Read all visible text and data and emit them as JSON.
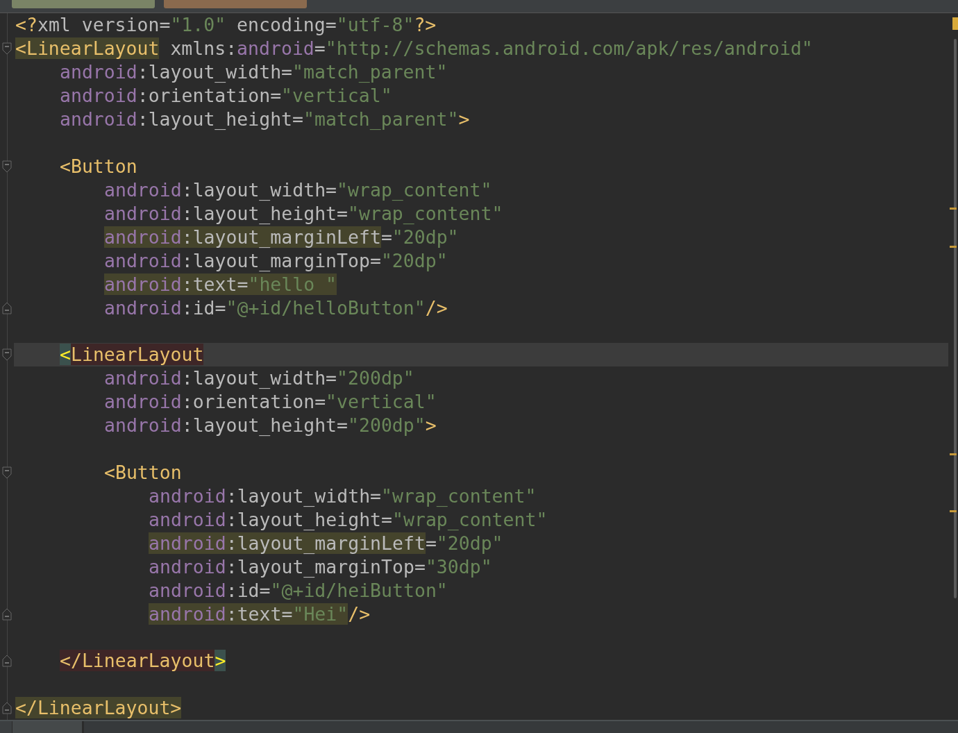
{
  "editor_tabs": [
    {
      "selected": false
    },
    {
      "selected": true
    }
  ],
  "lines": [
    {
      "current": false,
      "fold_start": false,
      "fold_end": false,
      "tokens": [
        {
          "kind": "bracket",
          "text": "<?",
          "warn": false,
          "match": false
        },
        {
          "kind": "attr",
          "text": "xml version=",
          "warn": false,
          "match": false
        },
        {
          "kind": "value",
          "text": "\"1.0\"",
          "warn": false,
          "match": false
        },
        {
          "kind": "attr",
          "text": " encoding=",
          "warn": false,
          "match": false
        },
        {
          "kind": "value",
          "text": "\"utf-8\"",
          "warn": false,
          "match": false
        },
        {
          "kind": "bracket",
          "text": "?>",
          "warn": false,
          "match": false
        }
      ]
    },
    {
      "current": false,
      "fold_start": true,
      "fold_end": false,
      "tokens": [
        {
          "kind": "tag",
          "text": "<LinearLayout",
          "warn": true,
          "match": false
        },
        {
          "kind": "attr",
          "text": " xmlns:",
          "warn": false,
          "match": false
        },
        {
          "kind": "ns",
          "text": "android",
          "warn": false,
          "match": false
        },
        {
          "kind": "attr",
          "text": "=",
          "warn": false,
          "match": false
        },
        {
          "kind": "value",
          "text": "\"http://schemas.android.com/apk/res/android\"",
          "warn": false,
          "match": false
        }
      ],
      "children": [
        {
          "current": false,
          "fold_start": false,
          "fold_end": false,
          "tokens": [
            {
              "kind": "ns",
              "text": "android",
              "warn": false,
              "match": false
            },
            {
              "kind": "attr",
              "text": ":layout_width=",
              "warn": false,
              "match": false
            },
            {
              "kind": "value",
              "text": "\"match_parent\"",
              "warn": false,
              "match": false
            }
          ]
        },
        {
          "current": false,
          "fold_start": false,
          "fold_end": false,
          "tokens": [
            {
              "kind": "ns",
              "text": "android",
              "warn": false,
              "match": false
            },
            {
              "kind": "attr",
              "text": ":orientation=",
              "warn": false,
              "match": false
            },
            {
              "kind": "value",
              "text": "\"vertical\"",
              "warn": false,
              "match": false
            }
          ]
        },
        {
          "current": false,
          "fold_start": false,
          "fold_end": false,
          "tokens": [
            {
              "kind": "ns",
              "text": "android",
              "warn": false,
              "match": false
            },
            {
              "kind": "attr",
              "text": ":layout_height=",
              "warn": false,
              "match": false
            },
            {
              "kind": "value",
              "text": "\"match_parent\"",
              "warn": false,
              "match": false
            },
            {
              "kind": "bracket",
              "text": ">",
              "warn": false,
              "match": false
            }
          ]
        },
        {
          "current": false,
          "fold_start": false,
          "fold_end": false
        },
        {
          "current": false,
          "fold_start": true,
          "fold_end": false,
          "tokens": [
            {
              "kind": "tag",
              "text": "<Button",
              "warn": false,
              "match": false
            }
          ],
          "children": [
            {
              "current": false,
              "fold_start": false,
              "fold_end": false,
              "tokens": [
                {
                  "kind": "ns",
                  "text": "android",
                  "warn": false,
                  "match": false
                },
                {
                  "kind": "attr",
                  "text": ":layout_width=",
                  "warn": false,
                  "match": false
                },
                {
                  "kind": "value",
                  "text": "\"wrap_content\"",
                  "warn": false,
                  "match": false
                }
              ]
            },
            {
              "current": false,
              "fold_start": false,
              "fold_end": false,
              "tokens": [
                {
                  "kind": "ns",
                  "text": "android",
                  "warn": false,
                  "match": false
                },
                {
                  "kind": "attr",
                  "text": ":layout_height=",
                  "warn": false,
                  "match": false
                },
                {
                  "kind": "value",
                  "text": "\"wrap_content\"",
                  "warn": false,
                  "match": false
                }
              ]
            },
            {
              "current": false,
              "fold_start": false,
              "fold_end": false,
              "tokens": [
                {
                  "kind": "ns",
                  "text": "android",
                  "warn": true,
                  "match": false
                },
                {
                  "kind": "attr",
                  "text": ":layout_marginLeft",
                  "warn": true,
                  "match": false
                },
                {
                  "kind": "attr",
                  "text": "=",
                  "warn": false,
                  "match": false
                },
                {
                  "kind": "value",
                  "text": "\"20dp\"",
                  "warn": false,
                  "match": false
                }
              ]
            },
            {
              "current": false,
              "fold_start": false,
              "fold_end": false,
              "tokens": [
                {
                  "kind": "ns",
                  "text": "android",
                  "warn": false,
                  "match": false
                },
                {
                  "kind": "attr",
                  "text": ":layout_marginTop=",
                  "warn": false,
                  "match": false
                },
                {
                  "kind": "value",
                  "text": "\"20dp\"",
                  "warn": false,
                  "match": false
                }
              ]
            },
            {
              "current": false,
              "fold_start": false,
              "fold_end": false,
              "tokens": [
                {
                  "kind": "ns",
                  "text": "android",
                  "warn": true,
                  "match": false
                },
                {
                  "kind": "attr",
                  "text": ":text=",
                  "warn": true,
                  "match": false
                },
                {
                  "kind": "value",
                  "text": "\"hello \"",
                  "warn": true,
                  "match": false
                }
              ]
            },
            {
              "current": false,
              "fold_start": false,
              "fold_end": true,
              "tokens": [
                {
                  "kind": "ns",
                  "text": "android",
                  "warn": false,
                  "match": false
                },
                {
                  "kind": "attr",
                  "text": ":id=",
                  "warn": false,
                  "match": false
                },
                {
                  "kind": "value",
                  "text": "\"@+id/helloButton\"",
                  "warn": false,
                  "match": false
                },
                {
                  "kind": "bracket",
                  "text": "/>",
                  "warn": false,
                  "match": false
                }
              ]
            }
          ]
        },
        {
          "current": false,
          "fold_start": false,
          "fold_end": false
        },
        {
          "current": true,
          "fold_start": true,
          "fold_end": false,
          "tokens": [
            {
              "kind": "bracket",
              "text": "<",
              "warn": false,
              "match": true
            },
            {
              "kind": "tag",
              "text": "LinearLayout",
              "warn": false,
              "match": true
            }
          ],
          "children": [
            {
              "current": false,
              "fold_start": false,
              "fold_end": false,
              "tokens": [
                {
                  "kind": "ns",
                  "text": "android",
                  "warn": false,
                  "match": false
                },
                {
                  "kind": "attr",
                  "text": ":layout_width=",
                  "warn": false,
                  "match": false
                },
                {
                  "kind": "value",
                  "text": "\"200dp\"",
                  "warn": false,
                  "match": false
                }
              ]
            },
            {
              "current": false,
              "fold_start": false,
              "fold_end": false,
              "tokens": [
                {
                  "kind": "ns",
                  "text": "android",
                  "warn": false,
                  "match": false
                },
                {
                  "kind": "attr",
                  "text": ":orientation=",
                  "warn": false,
                  "match": false
                },
                {
                  "kind": "value",
                  "text": "\"vertical\"",
                  "warn": false,
                  "match": false
                }
              ]
            },
            {
              "current": false,
              "fold_start": false,
              "fold_end": false,
              "tokens": [
                {
                  "kind": "ns",
                  "text": "android",
                  "warn": false,
                  "match": false
                },
                {
                  "kind": "attr",
                  "text": ":layout_height=",
                  "warn": false,
                  "match": false
                },
                {
                  "kind": "value",
                  "text": "\"200dp\"",
                  "warn": false,
                  "match": false
                },
                {
                  "kind": "bracket",
                  "text": ">",
                  "warn": false,
                  "match": false
                }
              ]
            },
            {
              "current": false,
              "fold_start": false,
              "fold_end": false
            },
            {
              "current": false,
              "fold_start": true,
              "fold_end": false,
              "tokens": [
                {
                  "kind": "tag",
                  "text": "<Button",
                  "warn": false,
                  "match": false
                }
              ],
              "children": [
                {
                  "current": false,
                  "fold_start": false,
                  "fold_end": false,
                  "tokens": [
                    {
                      "kind": "ns",
                      "text": "android",
                      "warn": false,
                      "match": false
                    },
                    {
                      "kind": "attr",
                      "text": ":layout_width=",
                      "warn": false,
                      "match": false
                    },
                    {
                      "kind": "value",
                      "text": "\"wrap_content\"",
                      "warn": false,
                      "match": false
                    }
                  ]
                },
                {
                  "current": false,
                  "fold_start": false,
                  "fold_end": false,
                  "tokens": [
                    {
                      "kind": "ns",
                      "text": "android",
                      "warn": false,
                      "match": false
                    },
                    {
                      "kind": "attr",
                      "text": ":layout_height=",
                      "warn": false,
                      "match": false
                    },
                    {
                      "kind": "value",
                      "text": "\"wrap_content\"",
                      "warn": false,
                      "match": false
                    }
                  ]
                },
                {
                  "current": false,
                  "fold_start": false,
                  "fold_end": false,
                  "tokens": [
                    {
                      "kind": "ns",
                      "text": "android",
                      "warn": true,
                      "match": false
                    },
                    {
                      "kind": "attr",
                      "text": ":layout_marginLeft",
                      "warn": true,
                      "match": false
                    },
                    {
                      "kind": "attr",
                      "text": "=",
                      "warn": false,
                      "match": false
                    },
                    {
                      "kind": "value",
                      "text": "\"20dp\"",
                      "warn": false,
                      "match": false
                    }
                  ]
                },
                {
                  "current": false,
                  "fold_start": false,
                  "fold_end": false,
                  "tokens": [
                    {
                      "kind": "ns",
                      "text": "android",
                      "warn": false,
                      "match": false
                    },
                    {
                      "kind": "attr",
                      "text": ":layout_marginTop=",
                      "warn": false,
                      "match": false
                    },
                    {
                      "kind": "value",
                      "text": "\"30dp\"",
                      "warn": false,
                      "match": false
                    }
                  ]
                },
                {
                  "current": false,
                  "fold_start": false,
                  "fold_end": false,
                  "tokens": [
                    {
                      "kind": "ns",
                      "text": "android",
                      "warn": false,
                      "match": false
                    },
                    {
                      "kind": "attr",
                      "text": ":id=",
                      "warn": false,
                      "match": false
                    },
                    {
                      "kind": "value",
                      "text": "\"@+id/heiButton\"",
                      "warn": false,
                      "match": false
                    }
                  ]
                },
                {
                  "current": false,
                  "fold_start": false,
                  "fold_end": true,
                  "tokens": [
                    {
                      "kind": "ns",
                      "text": "android",
                      "warn": true,
                      "match": false
                    },
                    {
                      "kind": "attr",
                      "text": ":text=",
                      "warn": true,
                      "match": false
                    },
                    {
                      "kind": "value",
                      "text": "\"Hei\"",
                      "warn": true,
                      "match": false
                    },
                    {
                      "kind": "bracket",
                      "text": "/>",
                      "warn": false,
                      "match": false
                    }
                  ]
                }
              ]
            },
            {
              "current": false,
              "fold_start": false,
              "fold_end": false
            }
          ]
        },
        {
          "current": false,
          "fold_start": false,
          "fold_end": true,
          "tokens": [
            {
              "kind": "tag",
              "text": "</LinearLayout",
              "warn": false,
              "match": true
            },
            {
              "kind": "bracket",
              "text": ">",
              "warn": false,
              "match": true
            }
          ]
        }
      ]
    },
    {
      "current": false,
      "fold_start": false,
      "fold_end": false
    },
    {
      "current": false,
      "fold_start": false,
      "fold_end": true,
      "tokens": [
        {
          "kind": "tag",
          "text": "</LinearLayout>",
          "warn": true,
          "match": false
        }
      ]
    }
  ]
}
